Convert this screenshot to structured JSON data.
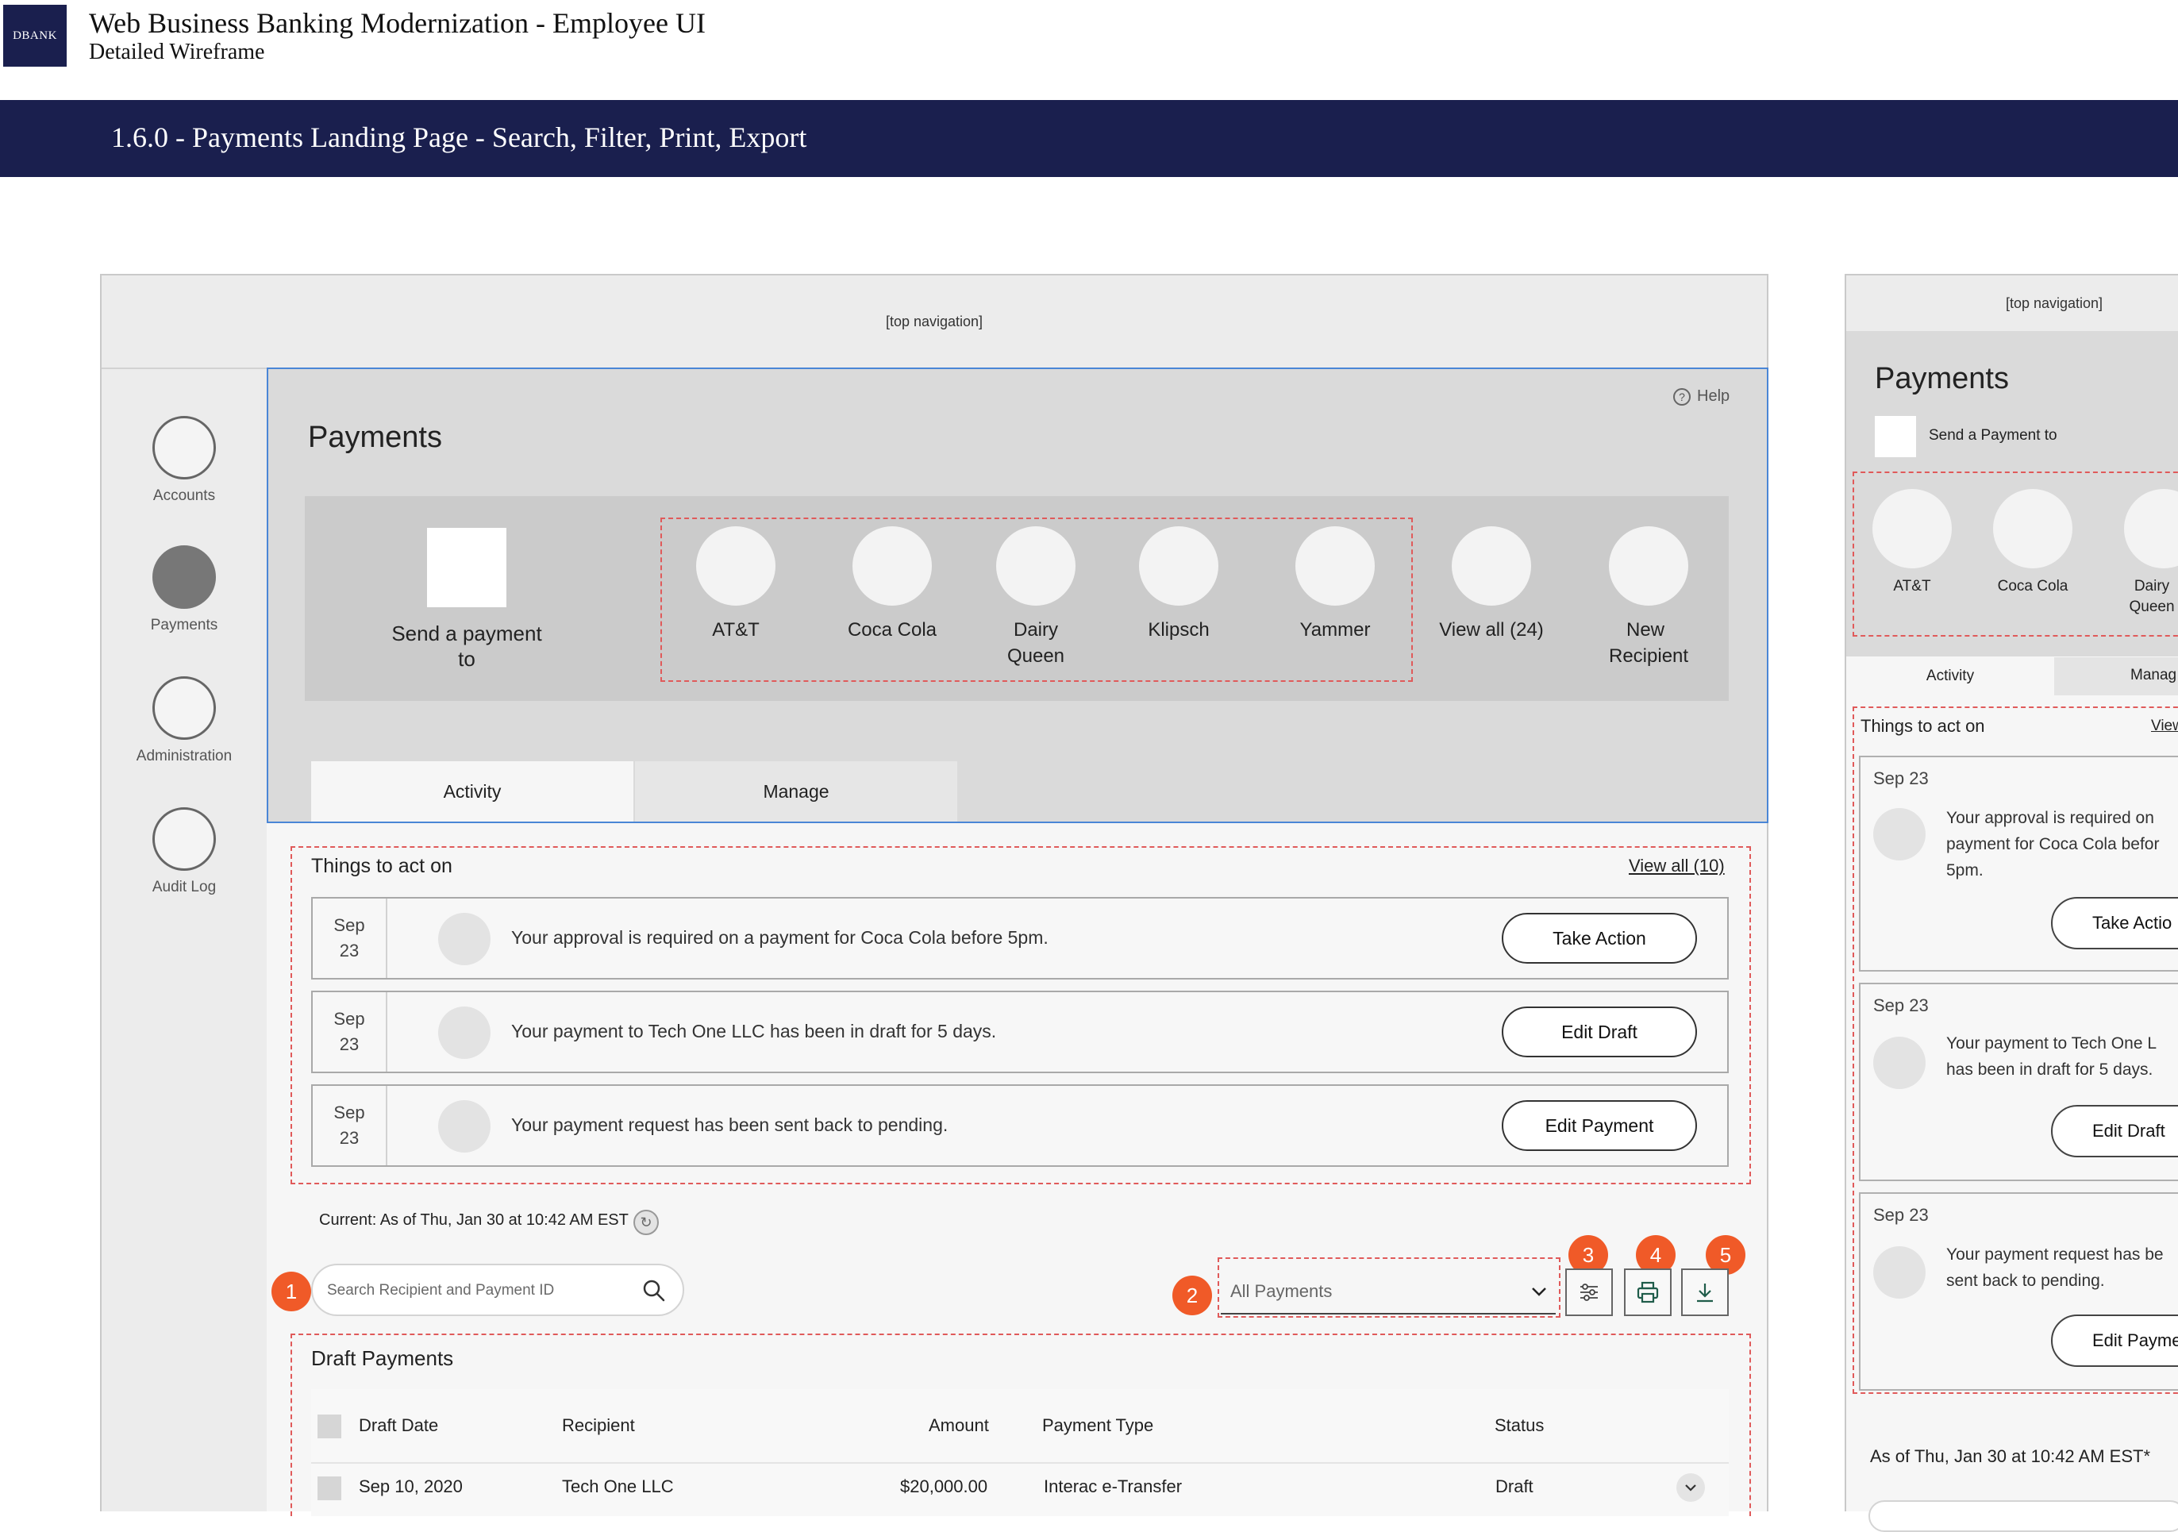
{
  "header": {
    "logo_text": "DBANK",
    "title": "Web Business Banking Modernization - Employee UI",
    "subtitle": "Detailed Wireframe",
    "banner": "1.6.0 - Payments Landing Page - Search, Filter, Print, Export"
  },
  "frame_main": {
    "top_nav_label": "[top navigation]",
    "side_nav": [
      {
        "label": "Accounts",
        "active": false
      },
      {
        "label": "Payments",
        "active": true
      },
      {
        "label": "Administration",
        "active": false
      },
      {
        "label": "Audit Log",
        "active": false
      }
    ],
    "help_label": "Help",
    "page_title": "Payments",
    "send_payment_label": "Send a payment to",
    "favorite_recipients": [
      "AT&T",
      "Coca Cola",
      "Dairy Queen",
      "Klipsch",
      "Yammer"
    ],
    "view_all_recipients": "View all (24)",
    "new_recipient": "New Recipient",
    "tabs": [
      {
        "label": "Activity",
        "selected": true
      },
      {
        "label": "Manage",
        "selected": false
      }
    ],
    "things_to_act_on": {
      "title": "Things to act on",
      "view_all": "View all (10)",
      "items": [
        {
          "month": "Sep",
          "day": "23",
          "text": "Your approval is required on a payment for Coca Cola before 5pm.",
          "action": "Take Action"
        },
        {
          "month": "Sep",
          "day": "23",
          "text": "Your payment to Tech One LLC has been in draft for 5 days.",
          "action": "Edit Draft"
        },
        {
          "month": "Sep",
          "day": "23",
          "text": "Your payment request has been sent back to pending.",
          "action": "Edit Payment"
        }
      ]
    },
    "current_label": "Current: As of Thu, Jan 30 at 10:42 AM EST",
    "search_placeholder": "Search Recipient and Payment ID",
    "filter_selected": "All Payments",
    "badges": [
      "1",
      "2",
      "3",
      "4",
      "5"
    ],
    "draft_payments": {
      "title": "Draft Payments",
      "columns": [
        "Draft Date",
        "Recipient",
        "Amount",
        "Payment Type",
        "Status"
      ],
      "rows": [
        {
          "date": "Sep 10, 2020",
          "recipient": "Tech One LLC",
          "amount": "$20,000.00",
          "type": "Interac e-Transfer",
          "status": "Draft"
        }
      ]
    }
  },
  "frame_mobile": {
    "top_nav_label": "[top navigation]",
    "page_title": "Payments",
    "send_payment_label": "Send a Payment to",
    "recipients": [
      "AT&T",
      "Coca Cola",
      "Dairy Queen"
    ],
    "tabs": [
      "Activity",
      "Manag"
    ],
    "act_title": "Things to act on",
    "act_view": "View",
    "cards": [
      {
        "date": "Sep 23",
        "lines": [
          "Your approval is required on",
          "payment for Coca Cola befor",
          "5pm."
        ],
        "action": "Take Actio"
      },
      {
        "date": "Sep 23",
        "lines": [
          "Your payment to Tech One L",
          "has been in draft for 5 days."
        ],
        "action": "Edit Draft"
      },
      {
        "date": "Sep 23",
        "lines": [
          "Your payment request has be",
          "sent back to pending."
        ],
        "action": "Edit Payme"
      }
    ],
    "as_of": "As of Thu, Jan 30 at 10:42 AM EST*"
  },
  "colors": {
    "brand_navy": "#1a1f4e",
    "badge_orange": "#f05a28",
    "annotation_red": "#e05a5a",
    "selection_blue": "#4a86d6"
  }
}
